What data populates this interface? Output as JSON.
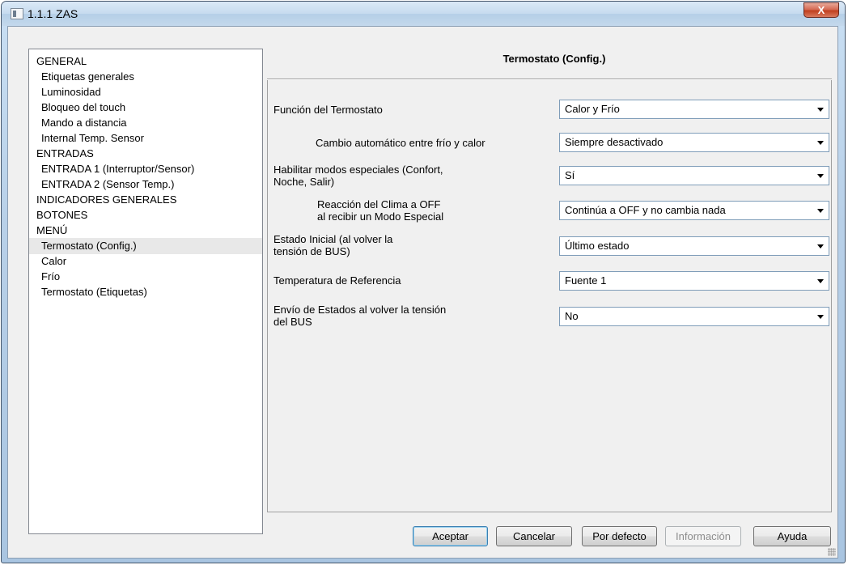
{
  "window": {
    "title": "1.1.1 ZAS",
    "close_label": "X"
  },
  "tree": {
    "items": [
      {
        "label": "GENERAL",
        "level": 0
      },
      {
        "label": "Etiquetas generales",
        "level": 1
      },
      {
        "label": "Luminosidad",
        "level": 1
      },
      {
        "label": "Bloqueo del touch",
        "level": 1
      },
      {
        "label": "Mando a distancia",
        "level": 1
      },
      {
        "label": "Internal Temp. Sensor",
        "level": 1
      },
      {
        "label": "ENTRADAS",
        "level": 0
      },
      {
        "label": "ENTRADA 1 (Interruptor/Sensor)",
        "level": 1
      },
      {
        "label": "ENTRADA 2 (Sensor Temp.)",
        "level": 1
      },
      {
        "label": "INDICADORES GENERALES",
        "level": 0
      },
      {
        "label": "BOTONES",
        "level": 0
      },
      {
        "label": "MENÚ",
        "level": 0
      },
      {
        "label": "Termostato (Config.)",
        "level": 1,
        "selected": true
      },
      {
        "label": "Calor",
        "level": 1
      },
      {
        "label": "Frío",
        "level": 1
      },
      {
        "label": "Termostato (Etiquetas)",
        "level": 1
      }
    ]
  },
  "panel": {
    "title": "Termostato (Config.)",
    "params": [
      {
        "label_lines": [
          "Función del Termostato"
        ],
        "value": "Calor y Frío"
      },
      {
        "label_lines": [
          "Cambio automático entre frío y calor"
        ],
        "value": "Siempre desactivado"
      },
      {
        "label_lines": [
          "Habilitar modos especiales (Confort,",
          "Noche, Salir)"
        ],
        "value": "Sí"
      },
      {
        "label_lines": [
          "Reacción del Clima a OFF",
          "al recibir un Modo Especial"
        ],
        "value": "Continúa a OFF y no cambia nada"
      },
      {
        "label_lines": [
          "Estado Inicial (al volver la",
          "tensión de BUS)"
        ],
        "value": "Último estado"
      },
      {
        "label_lines": [
          "Temperatura de Referencia"
        ],
        "value": "Fuente 1"
      },
      {
        "label_lines": [
          "Envío de Estados al volver la tensión",
          "del BUS"
        ],
        "value": "No"
      }
    ]
  },
  "buttons": {
    "accept": "Aceptar",
    "cancel": "Cancelar",
    "defaults": "Por defecto",
    "info": "Información",
    "help": "Ayuda"
  }
}
